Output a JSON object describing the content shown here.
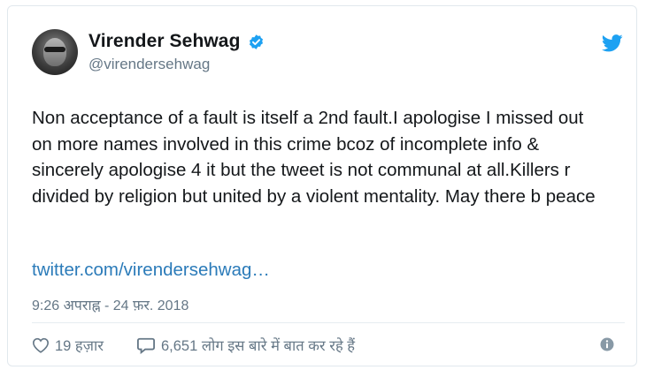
{
  "tweet": {
    "author": {
      "display_name": "Virender Sehwag",
      "handle": "@virendersehwag",
      "verified": true
    },
    "text": "Non acceptance of a fault is itself a 2nd fault.I apologise I missed out on more names involved in this crime bcoz of incomplete info & sincerely apologise 4 it but the tweet is not communal at all.Killers r divided by religion but united by a violent mentality. May there b peace",
    "link": "twitter.com/virendersehwag…",
    "timestamp": "9:26 अपराह्न - 24 फ़र. 2018",
    "likes": "19 हज़ार",
    "replies": "6,651 लोग इस बारे में बात कर रहे हैं"
  },
  "icons": {
    "brand": "twitter-bird-icon",
    "verified": "verified-badge-icon",
    "like": "heart-icon",
    "reply": "speech-bubble-icon",
    "info": "info-icon"
  },
  "colors": {
    "brand_blue": "#1da1f2",
    "link_blue": "#2b7bb9",
    "text": "#14171a",
    "secondary_text": "#657786",
    "border": "#e1e8ed"
  }
}
